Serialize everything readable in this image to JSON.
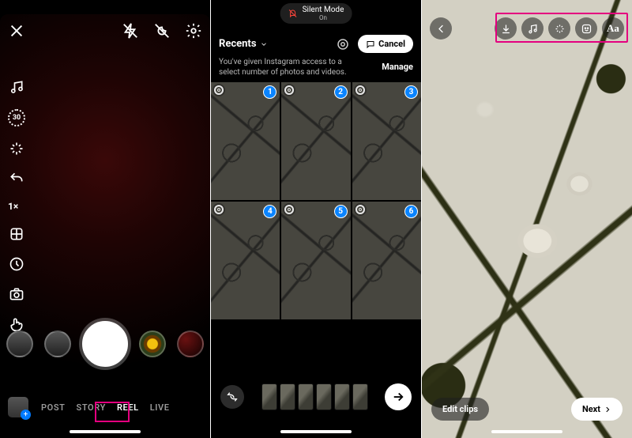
{
  "panel1": {
    "sidetools": {
      "duration": "30",
      "zoom": "1×"
    },
    "modes": {
      "post": "POST",
      "story": "STORY",
      "reel": "REEL",
      "live": "LIVE"
    }
  },
  "panel2": {
    "silent": {
      "title": "Silent Mode",
      "sub": "On"
    },
    "recents": "Recents",
    "cancel": "Cancel",
    "permission": {
      "msg": "You've given Instagram access to a select number of photos and videos.",
      "manage": "Manage"
    },
    "grid": [
      {
        "n": "1"
      },
      {
        "n": "2"
      },
      {
        "n": "3"
      },
      {
        "n": "4"
      },
      {
        "n": "5"
      },
      {
        "n": "6"
      }
    ],
    "clip_count": 6
  },
  "panel3": {
    "edit": "Edit clips",
    "next": "Next",
    "text_tool": "Aa"
  },
  "highlight_color": "#e4007f"
}
